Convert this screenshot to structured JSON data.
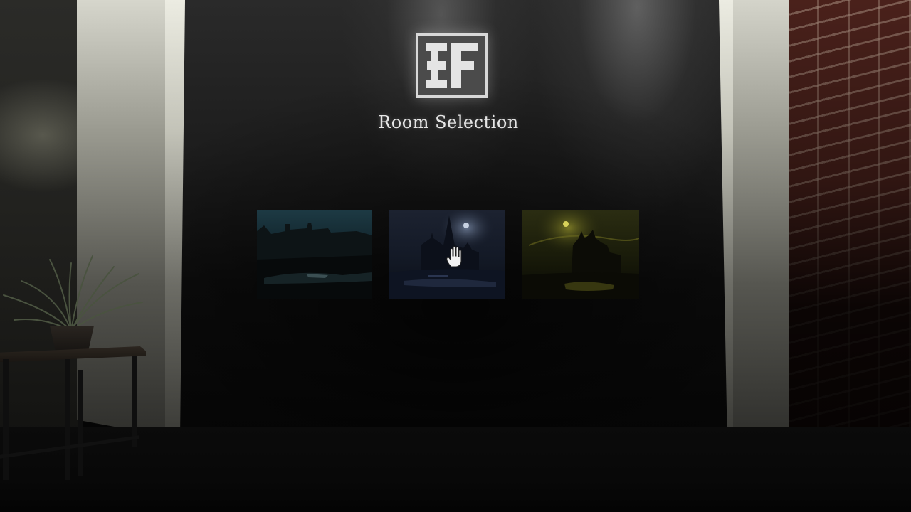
{
  "screen": {
    "title": "Room Selection"
  },
  "logo": {
    "icon": "ef-logo-icon",
    "text": "EF"
  },
  "rooms": [
    {
      "name": "room-1",
      "theme": "dark teal factory ruins"
    },
    {
      "name": "room-2",
      "theme": "moonlit gothic cathedral"
    },
    {
      "name": "room-3",
      "theme": "yellow-green haunted castle"
    }
  ],
  "cursor": {
    "icon": "hand-cursor-icon"
  },
  "colors": {
    "title_text": "#e6e6e6",
    "logo_border": "#d8d8d8",
    "logo_fill": "#4b4b4b",
    "wall": "#1d1d1d",
    "pillar": "#d6d6cc",
    "brick": "#4a211b"
  }
}
